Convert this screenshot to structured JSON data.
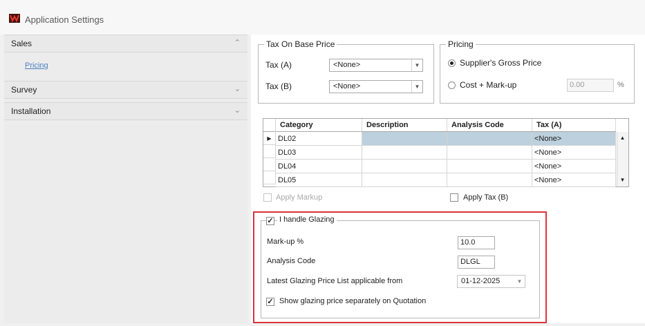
{
  "window": {
    "title": "Application Settings"
  },
  "sidebar": {
    "sections": [
      {
        "label": "Sales",
        "chevron": "chevron-up-icon",
        "items": [
          {
            "label": "Pricing"
          }
        ]
      },
      {
        "label": "Survey",
        "chevron": "chevron-down-icon"
      },
      {
        "label": "Installation",
        "chevron": "chevron-down-icon"
      }
    ]
  },
  "tax_on_base_price": {
    "legend": "Tax On Base Price",
    "tax_a_label": "Tax (A)",
    "tax_a_value": "<None>",
    "tax_b_label": "Tax (B)",
    "tax_b_value": "<None>"
  },
  "pricing": {
    "legend": "Pricing",
    "option_gross": "Supplier's Gross Price",
    "option_cost_markup": "Cost + Mark-up",
    "markup_value": "0.00",
    "percent_symbol": "%",
    "selected": "Supplier's Gross Price"
  },
  "grid": {
    "columns": [
      "Category",
      "Description",
      "Analysis Code",
      "Tax (A)"
    ],
    "rows": [
      {
        "category": "DL02",
        "description": "",
        "analysis_code": "",
        "tax_a": "<None>",
        "selected": true
      },
      {
        "category": "DL03",
        "description": "",
        "analysis_code": "",
        "tax_a": "<None>"
      },
      {
        "category": "DL04",
        "description": "",
        "analysis_code": "",
        "tax_a": "<None>"
      },
      {
        "category": "DL05",
        "description": "",
        "analysis_code": "",
        "tax_a": "<None>"
      }
    ]
  },
  "options": {
    "apply_markup": "Apply Markup",
    "apply_markup_checked": false,
    "apply_tax_b": "Apply Tax (B)",
    "apply_tax_b_checked": false
  },
  "glazing": {
    "legend": "I handle Glazing",
    "handle_checked": true,
    "markup_label": "Mark-up %",
    "markup_value": "10.0",
    "analysis_code_label": "Analysis Code",
    "analysis_code_value": "DLGL",
    "price_list_label": "Latest Glazing Price List applicable from",
    "price_list_date": "01-12-2025",
    "show_separately_label": "Show glazing price separately on Quotation",
    "show_separately_checked": true
  },
  "colors": {
    "highlight": "#d9343e",
    "link": "#4a7fc0",
    "selected_row": "#bcd0dd"
  }
}
